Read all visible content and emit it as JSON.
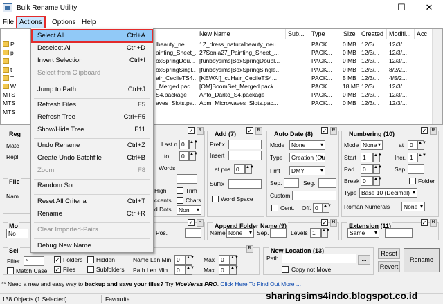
{
  "window": {
    "title": "Bulk Rename Utility",
    "min": "—",
    "max": "☐",
    "close": "✕"
  },
  "menubar": [
    "File",
    "Actions",
    "Options",
    "Help"
  ],
  "file_list": {
    "columns": [
      "New Name",
      "Sub...",
      "Type",
      "Size",
      "Created",
      "Modifi...",
      "Acc"
    ],
    "rows": [
      {
        "left": "P",
        "name": "lbeauty_ne...",
        "newname": "1Z_dress_naturalbeauty_neu...",
        "type": "PACK...",
        "size": "0 MB",
        "created": "12/3/...",
        "modified": "12/3/..."
      },
      {
        "left": "p",
        "name": "ainting_Sheet_...",
        "newname": "27Sonia27_Painting_Sheet_...",
        "type": "PACK...",
        "size": "0 MB",
        "created": "12/3/...",
        "modified": "12/3/..."
      },
      {
        "left": "T",
        "name": "oxSpringDou...",
        "newname": "[funboysims]BoxSpringDoubl...",
        "type": "PACK...",
        "size": "0 MB",
        "created": "12/3/...",
        "modified": "12/3/..."
      },
      {
        "left": "t",
        "name": "oxSpringSingl...",
        "newname": "[funboysims]BoxSpringSingle...",
        "type": "PACK...",
        "size": "0 MB",
        "created": "12/3/...",
        "modified": "8/2/2..."
      },
      {
        "left": "T",
        "name": "air_CecileTS4...",
        "newname": "[KEWAI]_cuHair_CecileTS4...",
        "type": "PACK...",
        "size": "5 MB",
        "created": "12/3/...",
        "modified": "4/5/2..."
      },
      {
        "left": "W",
        "name": "_Merged.pac...",
        "newname": "[OM]BoomSet_Merged.pack...",
        "type": "PACK...",
        "size": "18 MB",
        "created": "12/3/...",
        "modified": "12/3/..."
      },
      {
        "left": "MTS",
        "name": "S4.package",
        "newname": "Anto_Darko_S4.package",
        "type": "PACK...",
        "size": "0 MB",
        "created": "12/3/...",
        "modified": "12/3/..."
      },
      {
        "left": "MTS",
        "name": "aves_Slots.pa...",
        "newname": "Aom_Microwaves_Slots.pac...",
        "type": "PACK...",
        "size": "0 MB",
        "created": "12/3/...",
        "modified": "12/3/..."
      },
      {
        "left": "MTS",
        "name": "",
        "newname": "",
        "type": "",
        "size": "",
        "created": "",
        "modified": ""
      }
    ]
  },
  "actions_menu": {
    "items": [
      {
        "label": "Select All",
        "shortcut": "Ctrl+A",
        "state": "highlighted"
      },
      {
        "label": "Deselect All",
        "shortcut": "Ctrl+D",
        "state": "enabled"
      },
      {
        "label": "Invert Selection",
        "shortcut": "Ctrl+I",
        "state": "enabled"
      },
      {
        "label": "Select from Clipboard",
        "shortcut": "",
        "state": "disabled"
      },
      {
        "label": "Jump to Path",
        "shortcut": "Ctrl+J",
        "state": "enabled"
      },
      {
        "label": "Refresh Files",
        "shortcut": "F5",
        "state": "enabled"
      },
      {
        "label": "Refresh Tree",
        "shortcut": "Ctrl+F5",
        "state": "enabled"
      },
      {
        "label": "Show/Hide Tree",
        "shortcut": "F11",
        "state": "enabled"
      },
      {
        "label": "Undo Rename",
        "shortcut": "Ctrl+Z",
        "state": "enabled"
      },
      {
        "label": "Create Undo Batchfile",
        "shortcut": "Ctrl+B",
        "state": "enabled"
      },
      {
        "label": "Zoom",
        "shortcut": "F8",
        "state": "disabled"
      },
      {
        "label": "Random Sort",
        "shortcut": "",
        "state": "enabled"
      },
      {
        "label": "Reset All Criteria",
        "shortcut": "Ctrl+T",
        "state": "enabled"
      },
      {
        "label": "Rename",
        "shortcut": "Ctrl+R",
        "state": "enabled"
      },
      {
        "label": "Clear Imported-Pairs",
        "shortcut": "",
        "state": "disabled"
      },
      {
        "label": "Debug New Name",
        "shortcut": "",
        "state": "enabled"
      }
    ]
  },
  "panels": {
    "regex_title": "Reg",
    "regex_match": "Matc",
    "regex_repl": "Repl",
    "file_title": "File",
    "file_name": "Nam",
    "move_title": "Mo",
    "move_no": "No",
    "sel_title": "Sel",
    "remove": {
      "last_n": "Last n",
      "to": "to",
      "words": "Words",
      "high": "High",
      "trim": "Trim",
      "accents": "ccents",
      "chars": "Chars",
      "d_dots": "d Dots",
      "non": "Non"
    },
    "add": {
      "title": "Add (7)",
      "prefix": "Prefix",
      "insert": "Insert",
      "at_pos": "at pos.",
      "at_pos_val": "0",
      "suffix": "Suffix",
      "word_space": "Word Space"
    },
    "auto_date": {
      "title": "Auto Date (8)",
      "mode": "Mode",
      "mode_val": "None",
      "type": "Type",
      "type_val": "Creation (Cur",
      "fmt": "Fmt",
      "fmt_val": "DMY",
      "sep": "Sep.",
      "seg": "Seg.",
      "custom": "Custom",
      "cent": "Cent.",
      "off": "Off.",
      "off_val": "0"
    },
    "numbering": {
      "title": "Numbering (10)",
      "mode": "Mode",
      "mode_val": "None",
      "at": "at",
      "at_val": "0",
      "start": "Start",
      "start_val": "1",
      "incr": "Incr.",
      "incr_val": "1",
      "pad": "Pad",
      "pad_val": "0",
      "sep": "Sep.",
      "break": "Break",
      "break_val": "0",
      "folder": "Folder",
      "type": "Type",
      "type_val": "Base 10 (Decimal)",
      "roman": "Roman Numerals",
      "roman_val": "None"
    },
    "append_folder": {
      "title": "Append Folder Name (9)",
      "name": "Name",
      "name_val": "None",
      "sep": "Sep.",
      "levels": "Levels",
      "levels_val": "1"
    },
    "extension": {
      "title": "Extension (11)",
      "val": "Same"
    },
    "special_pos": "Pos.",
    "special_pos_val": "0",
    "selection": {
      "filter": "Filter",
      "filter_val": "*",
      "folders": "Folders",
      "hidden": "Hidden",
      "match_case": "Match Case",
      "files": "Files",
      "subfolders": "Subfolders",
      "name_len_min": "Name Len Min",
      "path_len_min": "Path Len Min",
      "max": "Max",
      "val0": "0"
    },
    "new_location": {
      "title": "New Location (13)",
      "path": "Path",
      "copy_not_move": "Copy not Move",
      "browse": "..."
    },
    "buttons": {
      "reset": "Reset",
      "revert": "Revert",
      "rename": "Rename"
    }
  },
  "promo": {
    "prefix": "** Need a new and easy way to ",
    "bold": "backup and save your files?",
    "mid": " Try ",
    "brand": "ViceVersa PRO",
    "dot": ". ",
    "link": "Click Here To Find Out More ..."
  },
  "status": {
    "objects": "138 Objects (1 Selected)",
    "favourite": "Favourite"
  },
  "watermark": "sharingsims4indo.blogspot.co.id",
  "colors": {
    "highlight": "#91c9f7",
    "annotation_red": "#e32b2b",
    "link": "#0645ad"
  }
}
